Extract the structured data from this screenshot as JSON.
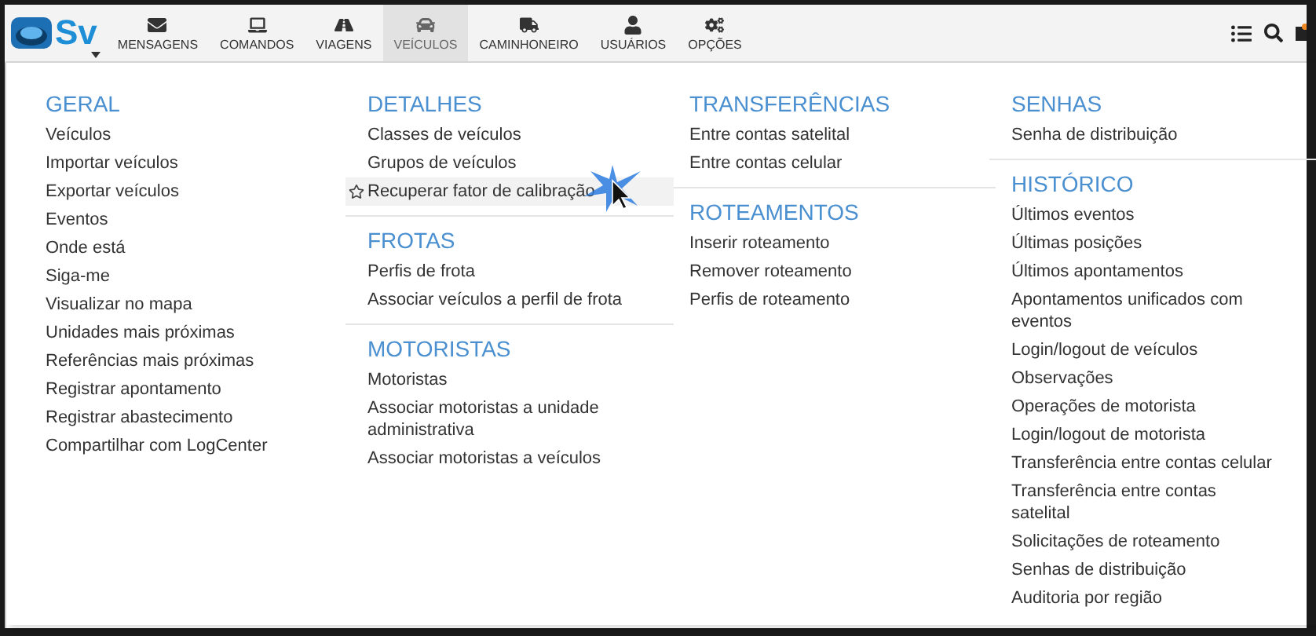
{
  "logo": {
    "text": "Sv"
  },
  "nav": [
    {
      "label": "MENSAGENS",
      "selected": false
    },
    {
      "label": "COMANDOS",
      "selected": false
    },
    {
      "label": "VIAGENS",
      "selected": false
    },
    {
      "label": "VEÍCULOS",
      "selected": true
    },
    {
      "label": "CAMINHONEIRO",
      "selected": false
    },
    {
      "label": "USUÁRIOS",
      "selected": false
    },
    {
      "label": "OPÇÕES",
      "selected": false
    }
  ],
  "menu": {
    "columns": [
      [
        {
          "title": "GERAL",
          "items": [
            {
              "label": "Veículos",
              "highlighted": false
            },
            {
              "label": "Importar veículos",
              "highlighted": false
            },
            {
              "label": "Exportar veículos",
              "highlighted": false
            },
            {
              "label": "Eventos",
              "highlighted": false
            },
            {
              "label": "Onde está",
              "highlighted": false
            },
            {
              "label": "Siga-me",
              "highlighted": false
            },
            {
              "label": "Visualizar no mapa",
              "highlighted": false
            },
            {
              "label": "Unidades mais próximas",
              "highlighted": false
            },
            {
              "label": "Referências mais próximas",
              "highlighted": false
            },
            {
              "label": "Registrar apontamento",
              "highlighted": false
            },
            {
              "label": "Registrar abastecimento",
              "highlighted": false
            },
            {
              "label": "Compartilhar com LogCenter",
              "highlighted": false
            }
          ]
        }
      ],
      [
        {
          "title": "DETALHES",
          "items": [
            {
              "label": "Classes de veículos",
              "highlighted": false
            },
            {
              "label": "Grupos de veículos",
              "highlighted": false
            },
            {
              "label": "Recuperar fator de calibração",
              "highlighted": true
            }
          ]
        },
        {
          "title": "FROTAS",
          "items": [
            {
              "label": "Perfis de frota",
              "highlighted": false
            },
            {
              "label": "Associar veículos a perfil de frota",
              "highlighted": false
            }
          ]
        },
        {
          "title": "MOTORISTAS",
          "items": [
            {
              "label": "Motoristas",
              "highlighted": false
            },
            {
              "label": "Associar motoristas a unidade administrativa",
              "highlighted": false
            },
            {
              "label": "Associar motoristas a veículos",
              "highlighted": false
            }
          ]
        }
      ],
      [
        {
          "title": "TRANSFERÊNCIAS",
          "items": [
            {
              "label": "Entre contas satelital",
              "highlighted": false
            },
            {
              "label": "Entre contas celular",
              "highlighted": false
            }
          ]
        },
        {
          "title": "ROTEAMENTOS",
          "items": [
            {
              "label": "Inserir roteamento",
              "highlighted": false
            },
            {
              "label": "Remover roteamento",
              "highlighted": false
            },
            {
              "label": "Perfis de roteamento",
              "highlighted": false
            }
          ]
        }
      ],
      [
        {
          "title": "SENHAS",
          "items": [
            {
              "label": "Senha de distribuição",
              "highlighted": false
            }
          ]
        },
        {
          "title": "HISTÓRICO",
          "items": [
            {
              "label": "Últimos eventos",
              "highlighted": false
            },
            {
              "label": "Últimas posições",
              "highlighted": false
            },
            {
              "label": "Últimos apontamentos",
              "highlighted": false
            },
            {
              "label": "Apontamentos unificados com eventos",
              "highlighted": false
            },
            {
              "label": "Login/logout de veículos",
              "highlighted": false
            },
            {
              "label": "Observações",
              "highlighted": false
            },
            {
              "label": "Operações de motorista",
              "highlighted": false
            },
            {
              "label": "Login/logout de motorista",
              "highlighted": false
            },
            {
              "label": "Transferência entre contas celular",
              "highlighted": false
            },
            {
              "label": "Transferência entre contas satelital",
              "highlighted": false
            },
            {
              "label": "Solicitações de roteamento",
              "highlighted": false
            },
            {
              "label": "Senhas de distribuição",
              "highlighted": false
            },
            {
              "label": "Auditoria por região",
              "highlighted": false
            }
          ]
        }
      ]
    ]
  }
}
